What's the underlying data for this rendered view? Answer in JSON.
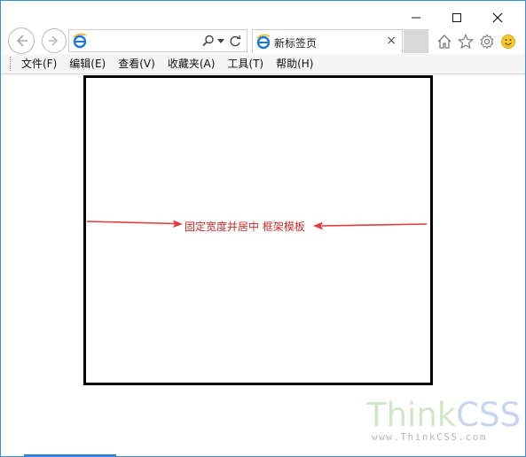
{
  "window": {
    "minimize_glyph": "—",
    "maximize_glyph": "☐",
    "close_glyph": "✕"
  },
  "address_bar": {
    "value": "",
    "placeholder": ""
  },
  "tab": {
    "title": "新标签页",
    "close_glyph": "×"
  },
  "menubar": {
    "items": [
      "文件(F)",
      "编辑(E)",
      "查看(V)",
      "收藏夹(A)",
      "工具(T)",
      "帮助(H)"
    ]
  },
  "content": {
    "center_text": "固定宽度并居中 框架模板",
    "frame_border_color": "#000000",
    "text_color": "#cc2a2a",
    "arrow_color": "#e8383a"
  },
  "watermark": {
    "brand_part1": "Think",
    "brand_part2": "CSS",
    "url": "www.ThinkCSS.com"
  },
  "colors": {
    "window_border": "#3c8fd8",
    "ie_logo": "#1b78d8"
  }
}
